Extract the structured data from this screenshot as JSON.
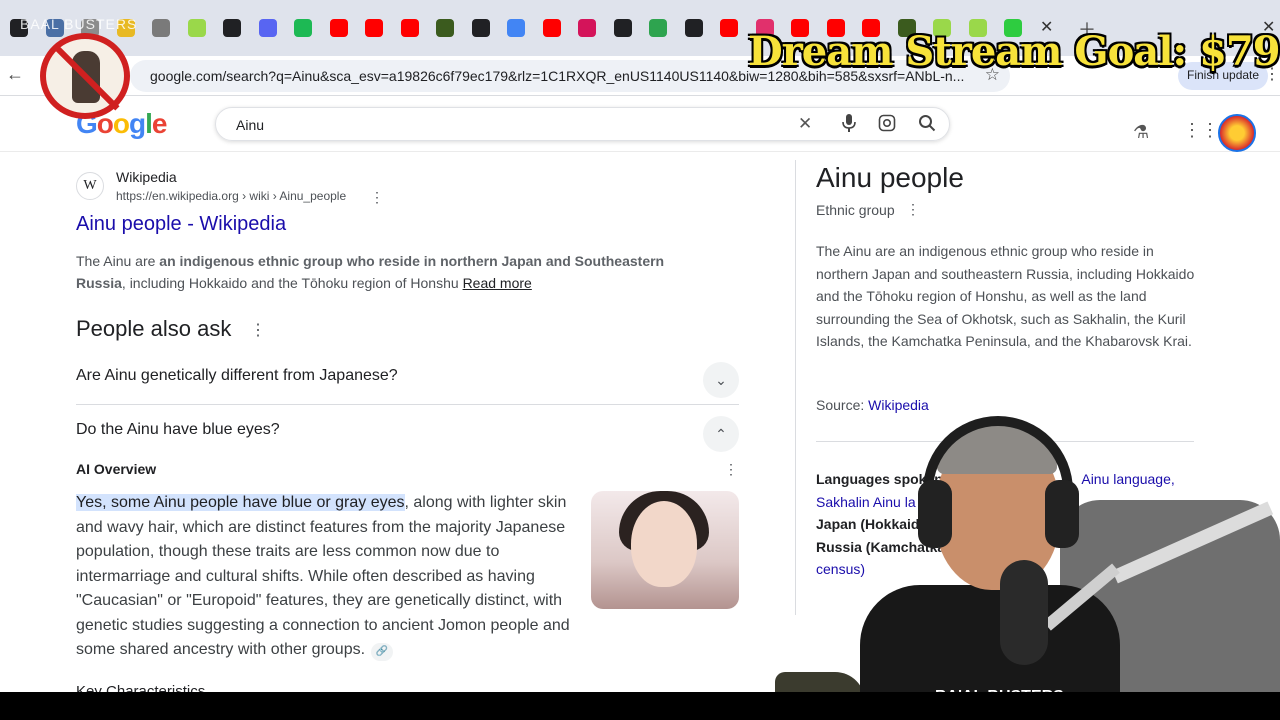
{
  "browser": {
    "url": "google.com/search?q=Ainu&sca_esv=a19826c6f79ec179&rlz=1C1RXQR_enUS1140US1140&biw=1280&bih=585&sxsrf=ANbL-n...",
    "finish_update": "Finish update",
    "tab_icon_colors": [
      "#202124",
      "#4a6fa5",
      "#8c8c8c",
      "#e8b923",
      "#7a7a7a",
      "#9ad84a",
      "#202124",
      "#5865f2",
      "#1db954",
      "#ff0000",
      "#ff0000",
      "#ff0000",
      "#3b5b1e",
      "#202124",
      "#4285f4",
      "#ff0000",
      "#d4145a",
      "#202124",
      "#2ea44f",
      "#202124",
      "#ff0000",
      "#e1306c",
      "#ff0000",
      "#ff0000",
      "#ff0000",
      "#3b5b1e",
      "#9ad84a",
      "#9ad84a",
      "#2ecc40"
    ]
  },
  "google": {
    "logo": "Google",
    "query": "Ainu"
  },
  "result": {
    "site_name": "Wikipedia",
    "site_url": "https://en.wikipedia.org › wiki › Ainu_people",
    "title": "Ainu people - Wikipedia",
    "snippet_start": "The Ainu are ",
    "snippet_bold": "an indigenous ethnic group who reside in northern Japan and Southeastern Russia",
    "snippet_end": ", including Hokkaido and the Tōhoku region of Honshu ",
    "read_more": "Read more"
  },
  "paa": {
    "title": "People also ask",
    "questions": [
      "Are Ainu genetically different from Japanese?",
      "Do the Ainu have blue eyes?"
    ]
  },
  "ai_overview": {
    "label": "AI Overview",
    "highlight": "Yes, some Ainu people have blue or gray eyes",
    "text": ", along with lighter skin and wavy hair, which are distinct features from the majority Japanese population, though these traits are less common now due to intermarriage and cultural shifts. While often described as having \"Caucasian\" or \"Europoid\" features, they are genetically distinct, with genetic studies suggesting a connection to ancient Jomon people and some shared ancestry with other groups."
  },
  "cutoff_text": "Key Characteristics",
  "knowledge_panel": {
    "title": "Ainu people",
    "subtitle": "Ethnic group",
    "description": "The Ainu are an indigenous ethnic group who reside in northern Japan and southeastern Russia, including Hokkaido and the Tōhoku region of Honshu, as well as the land surrounding the Sea of Okhotsk, such as Sakhalin, the Kuril Islands, the Kamchatka Peninsula, and the Khabarovsk Krai.",
    "source_label": "Source: ",
    "source_link": "Wikipedia",
    "languages_label": "Languages spoken: ",
    "languages_links": "Ainu language,",
    "languages_line2": "Sakhalin Ainu la",
    "region1": "Japan (Hokkaido",
    "region2": "Russia (Kamchatka,",
    "region3": "census)"
  },
  "overlay": {
    "brand": "BAAL BUSTERS",
    "goal": "Dream Stream Goal: $79",
    "shirt_text": "BA'AL BUSTERS"
  }
}
